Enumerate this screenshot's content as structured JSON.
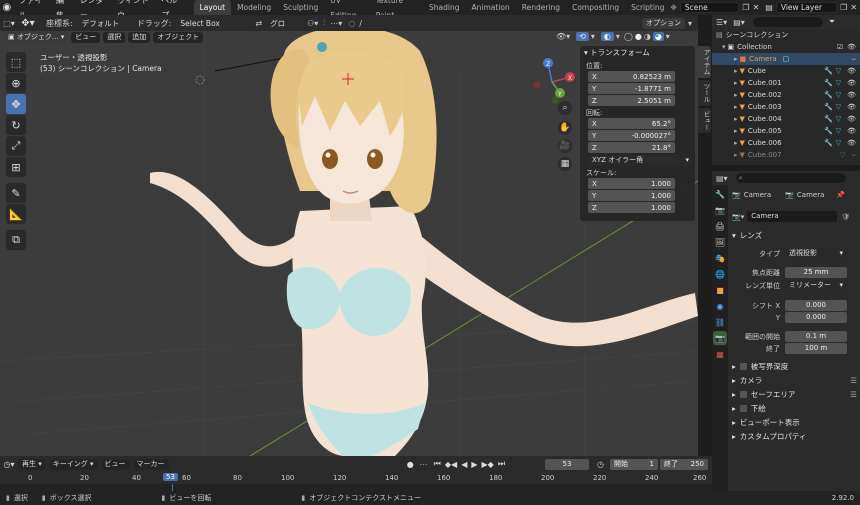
{
  "topbar": {
    "menus": [
      "ファイル",
      "編集",
      "レンダー",
      "ウィンドウ",
      "ヘルプ"
    ],
    "workspaces": [
      "Layout",
      "Modeling",
      "Sculpting",
      "UV Editing",
      "Texture Paint",
      "Shading",
      "Animation",
      "Rendering",
      "Compositing",
      "Scripting"
    ],
    "active_workspace": "Layout",
    "scene": "Scene",
    "view_layer": "View Layer"
  },
  "viewport_header": {
    "coord_label": "座標系:",
    "coord_value": "デフォルト",
    "drag_label": "ドラッグ:",
    "drag_value": "Select Box",
    "pivot_value": "グロー...",
    "options": "オプション",
    "mode": "オブジェク...",
    "menus": [
      "ビュー",
      "選択",
      "追加",
      "オブジェクト"
    ]
  },
  "viewport_info": {
    "line1": "ユーザー・透視投影",
    "line2": "(53) シーンコレクション | Camera"
  },
  "npanel": {
    "title": "トランスフォーム",
    "location_label": "位置:",
    "location": [
      {
        "axis": "X",
        "value": "0.82523 m"
      },
      {
        "axis": "Y",
        "value": "-1.8771 m"
      },
      {
        "axis": "Z",
        "value": "2.5051 m"
      }
    ],
    "rotation_label": "回転:",
    "rotation": [
      {
        "axis": "X",
        "value": "65.2°"
      },
      {
        "axis": "Y",
        "value": "-0.000027°"
      },
      {
        "axis": "Z",
        "value": "21.8°"
      }
    ],
    "rotation_mode": "XYZ オイラー角",
    "scale_label": "スケール:",
    "scale": [
      {
        "axis": "X",
        "value": "1.000"
      },
      {
        "axis": "Y",
        "value": "1.000"
      },
      {
        "axis": "Z",
        "value": "1.000"
      }
    ],
    "tabs": [
      "アイテム",
      "ツール",
      "ビュー"
    ]
  },
  "outliner": {
    "root": "シーンコレクション",
    "collection": "Collection",
    "items": [
      "Camera",
      "Cube",
      "Cube.001",
      "Cube.002",
      "Cube.003",
      "Cube.004",
      "Cube.005",
      "Cube.006",
      "Cube.007"
    ]
  },
  "properties": {
    "object_name": "Camera",
    "object_data_name": "Camera",
    "data_block": "Camera",
    "lens_section": "レンズ",
    "type_label": "タイプ",
    "type_value": "透視投影",
    "focal_label": "焦点距離",
    "focal_value": "25 mm",
    "lens_unit_label": "レンズ単位",
    "lens_unit_value": "ミリメーター",
    "shift_x_label": "シフト X",
    "shift_x_value": "0.000",
    "shift_y_label": "Y",
    "shift_y_value": "0.000",
    "clip_start_label": "範囲の開始",
    "clip_start_value": "0.1 m",
    "clip_end_label": "終了",
    "clip_end_value": "100 m",
    "sections": [
      "被写界深度",
      "カメラ",
      "セーフエリア",
      "下絵",
      "ビューポート表示",
      "カスタムプロパティ"
    ]
  },
  "timeline": {
    "menus": [
      "再生",
      "キーイング",
      "ビュー",
      "マーカー"
    ],
    "current_frame": "53",
    "start_label": "開始",
    "start_value": "1",
    "end_label": "終了",
    "end_value": "250",
    "ticks": [
      "0",
      "20",
      "40",
      "60",
      "80",
      "100",
      "120",
      "140",
      "160",
      "180",
      "200",
      "220",
      "240",
      "260"
    ]
  },
  "statusbar": {
    "select": "選択",
    "box_select": "ボックス選択",
    "rotate_view": "ビューを回転",
    "context_menu": "オブジェクトコンテクストメニュー",
    "version": "2.92.0"
  },
  "colors": {
    "accent": "#4772b3",
    "viewport_bg": "#3c3c3c",
    "camera_highlight": "#e07a3c",
    "mesh_icon": "#e8a050"
  }
}
